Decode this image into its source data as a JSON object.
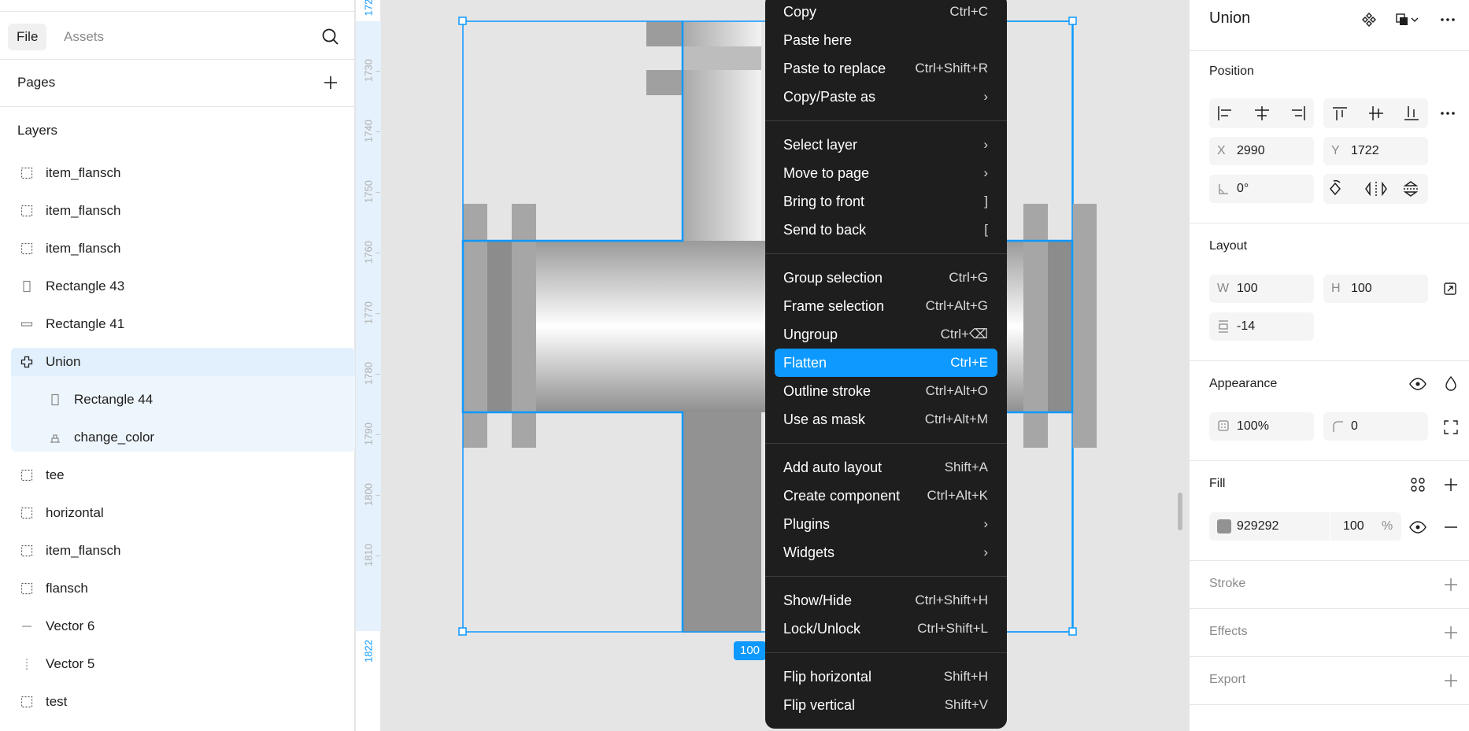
{
  "left_panel": {
    "tabs": {
      "file": "File",
      "assets": "Assets"
    },
    "pages_title": "Pages",
    "layers_title": "Layers",
    "layers": [
      {
        "name": "item_flansch",
        "icon": "frame-icon"
      },
      {
        "name": "item_flansch",
        "icon": "frame-icon"
      },
      {
        "name": "item_flansch",
        "icon": "frame-icon"
      },
      {
        "name": "Rectangle 43",
        "icon": "rectangle-icon"
      },
      {
        "name": "Rectangle 41",
        "icon": "rectangle-icon"
      },
      {
        "name": "Union",
        "icon": "union-icon",
        "selected": true
      },
      {
        "name": "Rectangle 44",
        "icon": "rectangle-icon",
        "child": true
      },
      {
        "name": "change_color",
        "icon": "component-icon",
        "child": true
      },
      {
        "name": "tee",
        "icon": "frame-icon"
      },
      {
        "name": "horizontal",
        "icon": "frame-icon"
      },
      {
        "name": "item_flansch",
        "icon": "frame-icon"
      },
      {
        "name": "flansch",
        "icon": "frame-icon"
      },
      {
        "name": "Vector 6",
        "icon": "line-icon"
      },
      {
        "name": "Vector 5",
        "icon": "line-icon"
      },
      {
        "name": "test",
        "icon": "frame-icon"
      }
    ]
  },
  "ruler": {
    "labels": [
      "1730",
      "1740",
      "1750",
      "1760",
      "1770",
      "1780",
      "1790",
      "1800",
      "1810"
    ],
    "selection_start": "172",
    "selection_end": "1822"
  },
  "canvas": {
    "size_badge": "100"
  },
  "context_menu": {
    "groups": [
      [
        {
          "label": "Copy",
          "shortcut": "Ctrl+C"
        },
        {
          "label": "Paste here",
          "shortcut": ""
        },
        {
          "label": "Paste to replace",
          "shortcut": "Ctrl+Shift+R"
        },
        {
          "label": "Copy/Paste as",
          "shortcut": "›"
        }
      ],
      [
        {
          "label": "Select layer",
          "shortcut": "›"
        },
        {
          "label": "Move to page",
          "shortcut": "›"
        },
        {
          "label": "Bring to front",
          "shortcut": "]"
        },
        {
          "label": "Send to back",
          "shortcut": "["
        }
      ],
      [
        {
          "label": "Group selection",
          "shortcut": "Ctrl+G"
        },
        {
          "label": "Frame selection",
          "shortcut": "Ctrl+Alt+G"
        },
        {
          "label": "Ungroup",
          "shortcut": "Ctrl+⌫"
        },
        {
          "label": "Flatten",
          "shortcut": "Ctrl+E",
          "active": true
        },
        {
          "label": "Outline stroke",
          "shortcut": "Ctrl+Alt+O"
        },
        {
          "label": "Use as mask",
          "shortcut": "Ctrl+Alt+M"
        }
      ],
      [
        {
          "label": "Add auto layout",
          "shortcut": "Shift+A"
        },
        {
          "label": "Create component",
          "shortcut": "Ctrl+Alt+K"
        },
        {
          "label": "Plugins",
          "shortcut": "›"
        },
        {
          "label": "Widgets",
          "shortcut": "›"
        }
      ],
      [
        {
          "label": "Show/Hide",
          "shortcut": "Ctrl+Shift+H"
        },
        {
          "label": "Lock/Unlock",
          "shortcut": "Ctrl+Shift+L"
        }
      ],
      [
        {
          "label": "Flip horizontal",
          "shortcut": "Shift+H"
        },
        {
          "label": "Flip vertical",
          "shortcut": "Shift+V"
        }
      ]
    ]
  },
  "right_panel": {
    "title": "Union",
    "position": {
      "title": "Position",
      "x_label": "X",
      "x": "2990",
      "y_label": "Y",
      "y": "1722",
      "rotation": "0°"
    },
    "layout": {
      "title": "Layout",
      "w_label": "W",
      "w": "100",
      "h_label": "H",
      "h": "100",
      "spacing": "-14"
    },
    "appearance": {
      "title": "Appearance",
      "opacity": "100%",
      "radius": "0"
    },
    "fill": {
      "title": "Fill",
      "color_hex": "929292",
      "swatch": "#929292",
      "opacity": "100",
      "unit": "%"
    },
    "stroke_title": "Stroke",
    "effects_title": "Effects",
    "export_title": "Export"
  },
  "colors": {
    "accent": "#0d99ff",
    "menu_bg": "#1e1e1e",
    "selection_bg": "#e1f0fc"
  }
}
